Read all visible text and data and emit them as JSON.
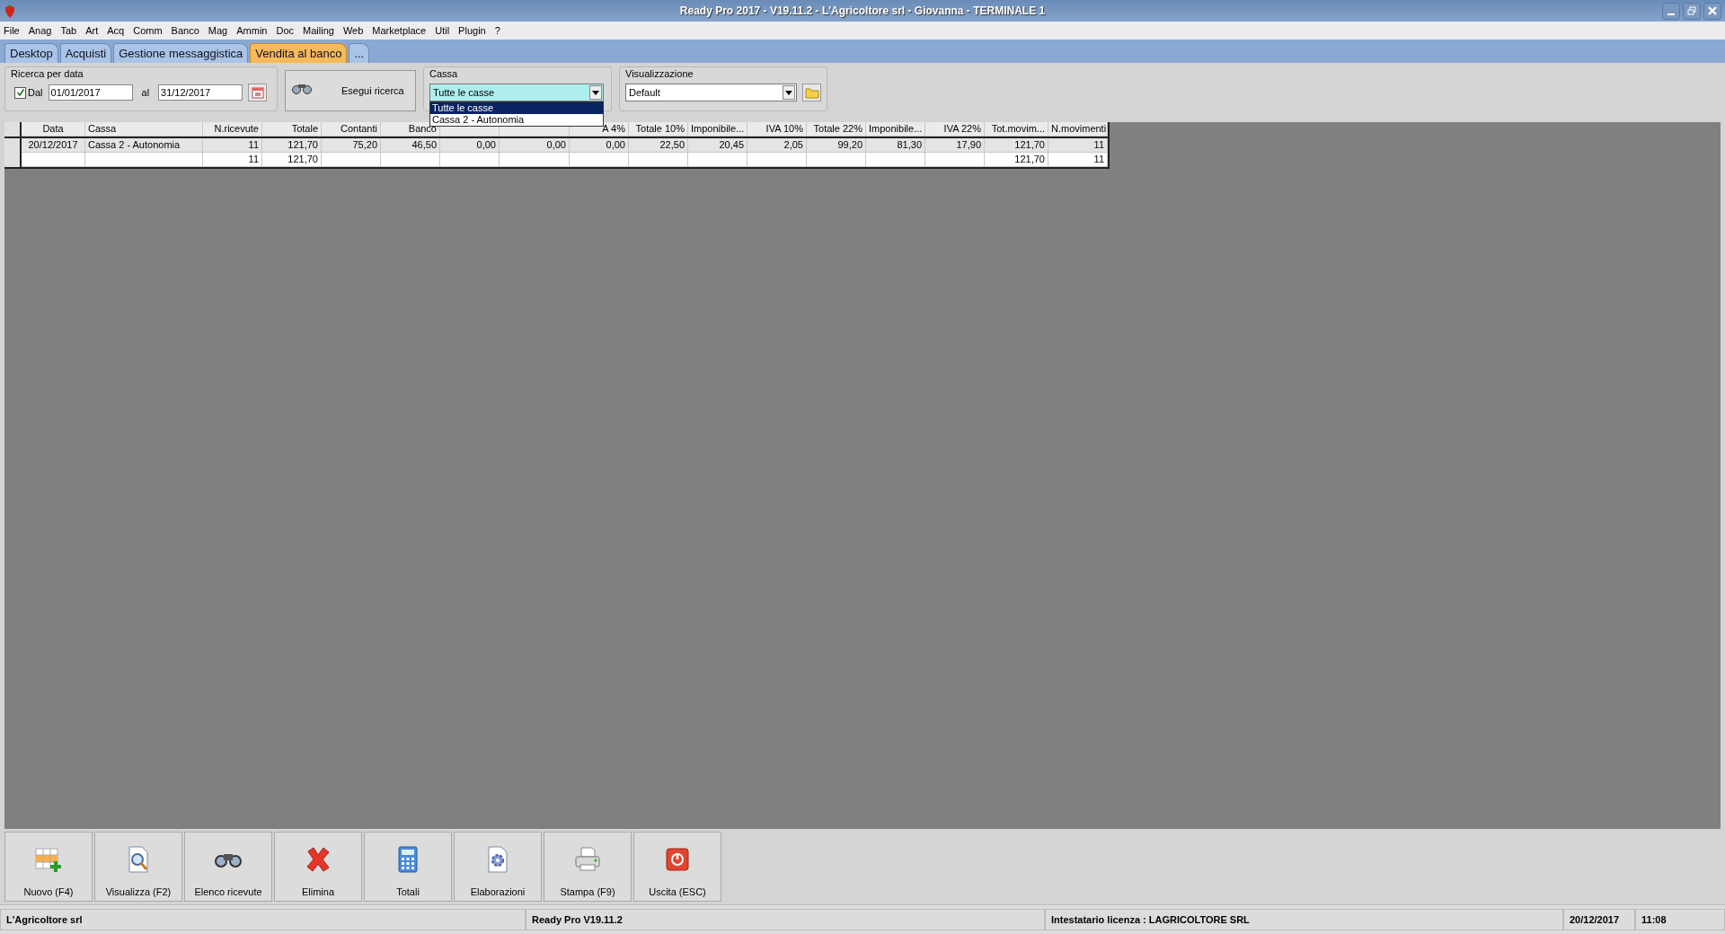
{
  "window": {
    "title": "Ready Pro 2017 - V19.11.2 - L'Agricoltore srl - Giovanna - TERMINALE 1"
  },
  "menu": [
    "File",
    "Anag",
    "Tab",
    "Art",
    "Acq",
    "Comm",
    "Banco",
    "Mag",
    "Ammin",
    "Doc",
    "Mailing",
    "Web",
    "Marketplace",
    "Util",
    "Plugin",
    "?"
  ],
  "tabs": [
    {
      "label": "Desktop",
      "selected": false
    },
    {
      "label": "Acquisti",
      "selected": false
    },
    {
      "label": "Gestione messaggistica",
      "selected": false
    },
    {
      "label": "Vendita al banco",
      "selected": true
    },
    {
      "label": "...",
      "selected": false
    }
  ],
  "date_filter": {
    "title": "Ricerca per data",
    "from_checked": true,
    "from_label": "Dal",
    "from": "01/01/2017",
    "to_label": "al",
    "to": "31/12/2017"
  },
  "search_button": "Esegui ricerca",
  "cassa": {
    "title": "Cassa",
    "value": "Tutte le casse",
    "options": [
      {
        "label": "Tutte le casse",
        "selected": true
      },
      {
        "label": "Cassa 2 - Autonomia",
        "selected": false
      }
    ]
  },
  "view": {
    "title": "Visualizzazione",
    "value": "Default"
  },
  "table": {
    "columns": [
      {
        "header": "Data"
      },
      {
        "header": "Cassa"
      },
      {
        "header": "N.ricevute"
      },
      {
        "header": "Totale"
      },
      {
        "header": "Contanti"
      },
      {
        "header": "Banco"
      },
      {},
      {},
      {
        "header": "A 4%"
      },
      {
        "header": "Totale 10%"
      },
      {
        "header": "Imponibile..."
      },
      {
        "header": "IVA 10%"
      },
      {
        "header": "Totale 22%"
      },
      {
        "header": "Imponibile..."
      },
      {
        "header": "IVA 22%"
      },
      {
        "header": "Tot.movim..."
      },
      {
        "header": "N.movimenti"
      }
    ],
    "rows": [
      {
        "selected": true,
        "cells": [
          "20/12/2017",
          "Cassa 2 - Autonomia",
          "11",
          "121,70",
          "75,20",
          "46,50",
          "0,00",
          "0,00",
          "0,00",
          "22,50",
          "20,45",
          "2,05",
          "99,20",
          "81,30",
          "17,90",
          "121,70",
          "11"
        ]
      },
      {
        "selected": false,
        "cells": [
          null,
          null,
          "11",
          "121,70",
          null,
          null,
          null,
          null,
          null,
          null,
          null,
          null,
          null,
          null,
          null,
          "121,70",
          "11"
        ]
      }
    ]
  },
  "buttons": [
    "Nuovo (F4)",
    "Visualizza (F2)",
    "Elenco ricevute",
    "Elimina",
    "Totali",
    "Elaborazioni",
    "Stampa (F9)",
    "Uscita (ESC)"
  ],
  "status_bar": [
    "L'Agricoltore srl",
    "Ready Pro V19.11.2",
    "Intestatario licenza : LAGRICOLTORE SRL",
    "20/12/2017",
    "11:08"
  ]
}
